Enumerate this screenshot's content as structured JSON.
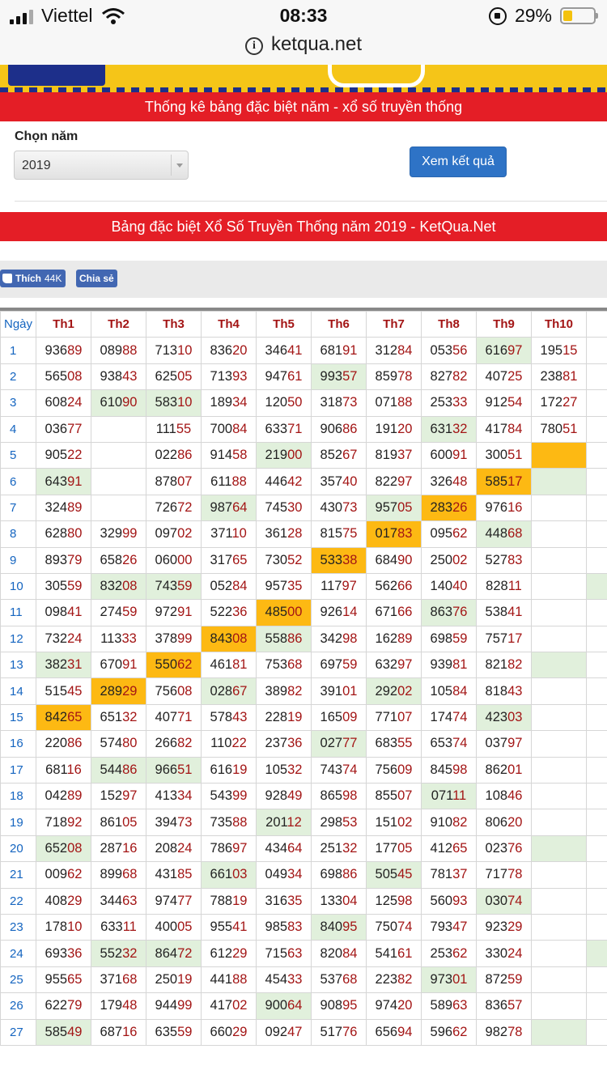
{
  "status_bar": {
    "carrier": "Viettel",
    "time": "08:33",
    "battery": "29%"
  },
  "browser": {
    "url": "ketqua.net"
  },
  "colors": {
    "red_bar": "#e41e26",
    "button_blue": "#2e73c6",
    "highlight_green": "#e1f0dc",
    "highlight_orange": "#fdb913",
    "day_blue": "#1565c0",
    "tail_red": "#a31515"
  },
  "header": {
    "title": "Thống kê bảng đặc biệt năm - xổ số truyền thống"
  },
  "form": {
    "year_label": "Chọn năm",
    "year_value": "2019",
    "submit_label": "Xem kết quả"
  },
  "section": {
    "title": "Bảng đặc biệt Xổ Số Truyền Thống năm 2019 - KetQua.Net"
  },
  "social": {
    "like_label": "Thích",
    "like_count": "44K",
    "share_label": "Chia sẻ"
  },
  "table": {
    "headers": [
      "Ngày",
      "Th1",
      "Th2",
      "Th3",
      "Th4",
      "Th5",
      "Th6",
      "Th7",
      "Th8",
      "Th9",
      "Th10",
      "Th"
    ],
    "rows": [
      {
        "day": "1",
        "cells": [
          "93689",
          "08988",
          "71310",
          "83620",
          "34641",
          "68191",
          "31284",
          "05356",
          "61697",
          "19515",
          ""
        ],
        "hl": [
          "",
          "",
          "",
          "",
          "",
          "",
          "",
          "",
          "g",
          "",
          ""
        ]
      },
      {
        "day": "2",
        "cells": [
          "56508",
          "93843",
          "62505",
          "71393",
          "94761",
          "99357",
          "85978",
          "82782",
          "40725",
          "23881",
          ""
        ],
        "hl": [
          "",
          "",
          "",
          "",
          "",
          "g",
          "",
          "",
          "",
          "",
          ""
        ]
      },
      {
        "day": "3",
        "cells": [
          "60824",
          "61090",
          "58310",
          "18934",
          "12050",
          "31873",
          "07188",
          "25333",
          "91254",
          "17227",
          ""
        ],
        "hl": [
          "",
          "g",
          "g",
          "",
          "",
          "",
          "",
          "",
          "",
          "",
          ""
        ]
      },
      {
        "day": "4",
        "cells": [
          "03677",
          "",
          "11155",
          "70084",
          "63371",
          "90686",
          "19120",
          "63132",
          "41784",
          "78051",
          ""
        ],
        "hl": [
          "",
          "",
          "",
          "",
          "",
          "",
          "",
          "g",
          "",
          "",
          ""
        ]
      },
      {
        "day": "5",
        "cells": [
          "90522",
          "",
          "02286",
          "91458",
          "21900",
          "85267",
          "81937",
          "60091",
          "30051",
          "",
          ""
        ],
        "hl": [
          "",
          "",
          "",
          "",
          "g",
          "",
          "",
          "",
          "",
          "o",
          ""
        ]
      },
      {
        "day": "6",
        "cells": [
          "64391",
          "",
          "87807",
          "61188",
          "44642",
          "35740",
          "82297",
          "32648",
          "58517",
          "",
          ""
        ],
        "hl": [
          "g",
          "",
          "",
          "",
          "",
          "",
          "",
          "",
          "o",
          "g",
          ""
        ]
      },
      {
        "day": "7",
        "cells": [
          "32489",
          "",
          "72672",
          "98764",
          "74530",
          "43073",
          "95705",
          "28326",
          "97616",
          "",
          ""
        ],
        "hl": [
          "",
          "",
          "",
          "g",
          "",
          "",
          "g",
          "o",
          "",
          "",
          ""
        ]
      },
      {
        "day": "8",
        "cells": [
          "62880",
          "32999",
          "09702",
          "37110",
          "36128",
          "81575",
          "01783",
          "09562",
          "44868",
          "",
          ""
        ],
        "hl": [
          "",
          "",
          "",
          "",
          "",
          "",
          "o",
          "",
          "g",
          "",
          ""
        ]
      },
      {
        "day": "9",
        "cells": [
          "89379",
          "65826",
          "06000",
          "31765",
          "73052",
          "53338",
          "68490",
          "25002",
          "52783",
          "",
          ""
        ],
        "hl": [
          "",
          "",
          "",
          "",
          "",
          "o",
          "",
          "",
          "",
          "",
          ""
        ]
      },
      {
        "day": "10",
        "cells": [
          "30559",
          "83208",
          "74359",
          "05284",
          "95735",
          "11797",
          "56266",
          "14040",
          "82811",
          "",
          ""
        ],
        "hl": [
          "",
          "g",
          "g",
          "",
          "",
          "",
          "",
          "",
          "",
          "",
          "g"
        ]
      },
      {
        "day": "11",
        "cells": [
          "09841",
          "27459",
          "97291",
          "52236",
          "48500",
          "92614",
          "67166",
          "86376",
          "53841",
          "",
          ""
        ],
        "hl": [
          "",
          "",
          "",
          "",
          "o",
          "",
          "",
          "g",
          "",
          "",
          ""
        ]
      },
      {
        "day": "12",
        "cells": [
          "73224",
          "11333",
          "37899",
          "84308",
          "55886",
          "34298",
          "16289",
          "69859",
          "75717",
          "",
          ""
        ],
        "hl": [
          "",
          "",
          "",
          "o",
          "g",
          "",
          "",
          "",
          "",
          "",
          ""
        ]
      },
      {
        "day": "13",
        "cells": [
          "38231",
          "67091",
          "55062",
          "46181",
          "75368",
          "69759",
          "63297",
          "93981",
          "82182",
          "",
          ""
        ],
        "hl": [
          "g",
          "",
          "o",
          "",
          "",
          "",
          "",
          "",
          "",
          "g",
          ""
        ]
      },
      {
        "day": "14",
        "cells": [
          "51545",
          "28929",
          "75608",
          "02867",
          "38982",
          "39101",
          "29202",
          "10584",
          "81843",
          "",
          ""
        ],
        "hl": [
          "",
          "o",
          "",
          "g",
          "",
          "",
          "g",
          "",
          "",
          "",
          ""
        ]
      },
      {
        "day": "15",
        "cells": [
          "84265",
          "65132",
          "40771",
          "57843",
          "22819",
          "16509",
          "77107",
          "17474",
          "42303",
          "",
          ""
        ],
        "hl": [
          "o",
          "",
          "",
          "",
          "",
          "",
          "",
          "",
          "g",
          "",
          ""
        ]
      },
      {
        "day": "16",
        "cells": [
          "22086",
          "57480",
          "26682",
          "11022",
          "23736",
          "02777",
          "68355",
          "65374",
          "03797",
          "",
          ""
        ],
        "hl": [
          "",
          "",
          "",
          "",
          "",
          "g",
          "",
          "",
          "",
          "",
          ""
        ]
      },
      {
        "day": "17",
        "cells": [
          "68116",
          "54486",
          "96651",
          "61619",
          "10532",
          "74374",
          "75609",
          "84598",
          "86201",
          "",
          ""
        ],
        "hl": [
          "",
          "g",
          "g",
          "",
          "",
          "",
          "",
          "",
          "",
          "",
          ""
        ]
      },
      {
        "day": "18",
        "cells": [
          "04289",
          "15297",
          "41334",
          "54399",
          "92849",
          "86598",
          "85507",
          "07111",
          "10846",
          "",
          ""
        ],
        "hl": [
          "",
          "",
          "",
          "",
          "",
          "",
          "",
          "g",
          "",
          "",
          ""
        ]
      },
      {
        "day": "19",
        "cells": [
          "71892",
          "86105",
          "39473",
          "73588",
          "20112",
          "29853",
          "15102",
          "91082",
          "80620",
          "",
          ""
        ],
        "hl": [
          "",
          "",
          "",
          "",
          "g",
          "",
          "",
          "",
          "",
          "",
          ""
        ]
      },
      {
        "day": "20",
        "cells": [
          "65208",
          "28716",
          "20824",
          "78697",
          "43464",
          "25132",
          "17705",
          "41265",
          "02376",
          "",
          ""
        ],
        "hl": [
          "g",
          "",
          "",
          "",
          "",
          "",
          "",
          "",
          "",
          "g",
          ""
        ]
      },
      {
        "day": "21",
        "cells": [
          "00962",
          "89968",
          "43185",
          "66103",
          "04934",
          "69886",
          "50545",
          "78137",
          "71778",
          "",
          ""
        ],
        "hl": [
          "",
          "",
          "",
          "g",
          "",
          "",
          "g",
          "",
          "",
          "",
          ""
        ]
      },
      {
        "day": "22",
        "cells": [
          "40829",
          "34463",
          "97477",
          "78819",
          "31635",
          "13304",
          "12598",
          "56093",
          "03074",
          "",
          ""
        ],
        "hl": [
          "",
          "",
          "",
          "",
          "",
          "",
          "",
          "",
          "g",
          "",
          ""
        ]
      },
      {
        "day": "23",
        "cells": [
          "17810",
          "63311",
          "40005",
          "95541",
          "98583",
          "84095",
          "75074",
          "79347",
          "92329",
          "",
          ""
        ],
        "hl": [
          "",
          "",
          "",
          "",
          "",
          "g",
          "",
          "",
          "",
          "",
          ""
        ]
      },
      {
        "day": "24",
        "cells": [
          "69336",
          "55232",
          "86472",
          "61229",
          "71563",
          "82084",
          "54161",
          "25362",
          "33024",
          "",
          ""
        ],
        "hl": [
          "",
          "g",
          "g",
          "",
          "",
          "",
          "",
          "",
          "",
          "",
          "g"
        ]
      },
      {
        "day": "25",
        "cells": [
          "95565",
          "37168",
          "25019",
          "44188",
          "45433",
          "53768",
          "22382",
          "97301",
          "87259",
          "",
          ""
        ],
        "hl": [
          "",
          "",
          "",
          "",
          "",
          "",
          "",
          "g",
          "",
          "",
          ""
        ]
      },
      {
        "day": "26",
        "cells": [
          "62279",
          "17948",
          "94499",
          "41702",
          "90064",
          "90895",
          "97420",
          "58963",
          "83657",
          "",
          ""
        ],
        "hl": [
          "",
          "",
          "",
          "",
          "g",
          "",
          "",
          "",
          "",
          "",
          ""
        ]
      },
      {
        "day": "27",
        "cells": [
          "58549",
          "68716",
          "63559",
          "66029",
          "09247",
          "51776",
          "65694",
          "59662",
          "98278",
          "",
          ""
        ],
        "hl": [
          "g",
          "",
          "",
          "",
          "",
          "",
          "",
          "",
          "",
          "g",
          ""
        ]
      }
    ]
  }
}
